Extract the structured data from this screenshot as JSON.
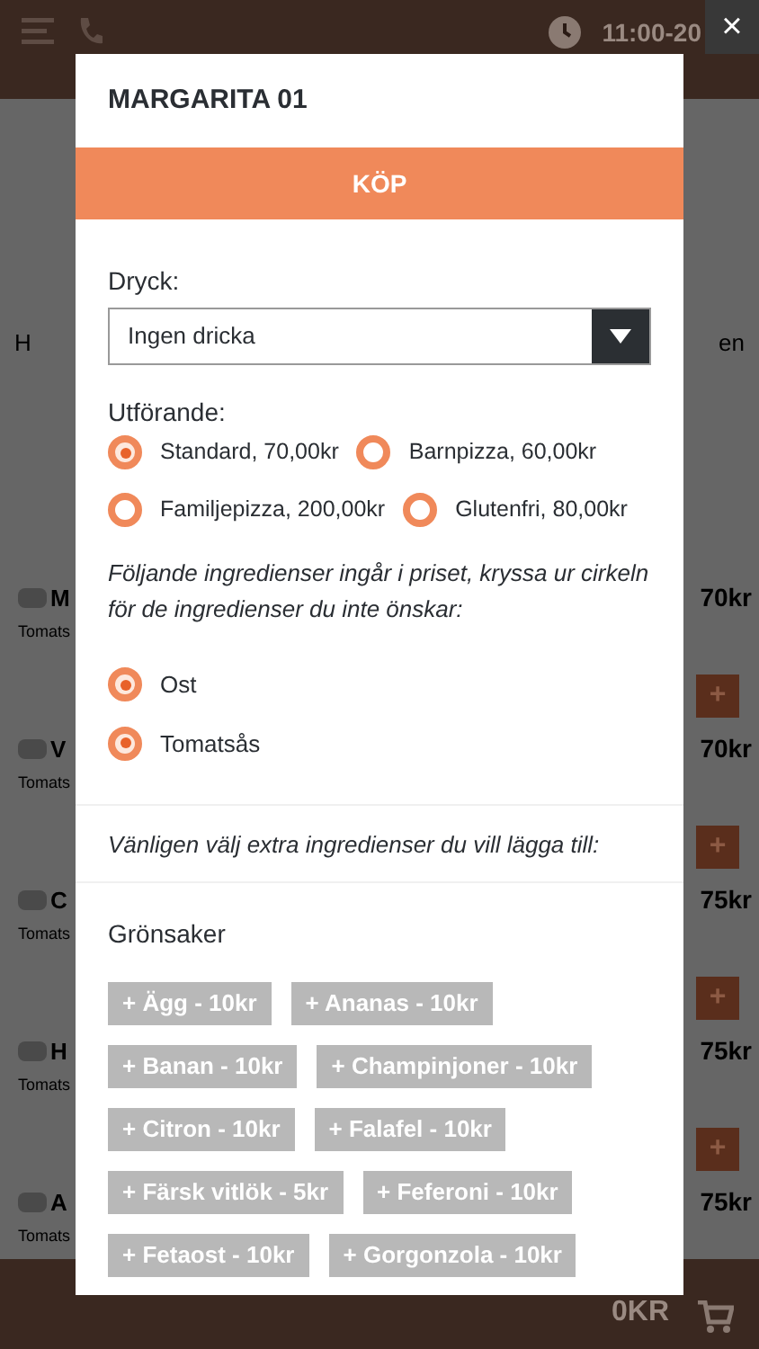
{
  "header": {
    "time": "11:00-20"
  },
  "background_tabs": [
    "H",
    "en"
  ],
  "menu_items": [
    {
      "name": "M",
      "checked": false,
      "description": "Tomats",
      "price": "70kr",
      "add_label": "+"
    },
    {
      "name": "V",
      "checked": false,
      "description": "Tomats",
      "price": "70kr",
      "add_label": "+"
    },
    {
      "name": "C",
      "checked": false,
      "description": "Tomats",
      "price": "75kr",
      "add_label": "+"
    },
    {
      "name": "H",
      "checked": false,
      "description": "Tomats",
      "price": "75kr",
      "add_label": "+"
    },
    {
      "name": "A",
      "checked": false,
      "description": "Tomats",
      "price": "75kr"
    }
  ],
  "cart": {
    "total": "0KR"
  },
  "close_button": "×",
  "modal": {
    "title": "MARGARITA 01",
    "buy_button": "KÖP",
    "drink": {
      "label": "Dryck:",
      "value": "Ingen dricka"
    },
    "variant": {
      "label": "Utförande:",
      "options": [
        {
          "label": "Standard, 70,00kr",
          "selected": true
        },
        {
          "label": "Barnpizza, 60,00kr",
          "selected": false
        },
        {
          "label": "Familjepizza, 200,00kr",
          "selected": false
        },
        {
          "label": "Glutenfri, 80,00kr",
          "selected": false
        }
      ]
    },
    "included": {
      "note": "Följande ingredienser ingår i priset, kryssa ur cirkeln för de ingredienser du inte önskar:",
      "ingredients": [
        {
          "label": "Ost",
          "checked": true
        },
        {
          "label": "Tomatsås",
          "checked": true
        }
      ]
    },
    "extras": {
      "note": "Vänligen välj extra ingredienser du vill lägga till:",
      "category": "Grönsaker",
      "items": [
        "+ Ägg - 10kr",
        "+ Ananas - 10kr",
        "+ Banan - 10kr",
        "+ Champinjoner - 10kr",
        "+ Citron - 10kr",
        "+ Falafel - 10kr",
        "+ Färsk vitlök - 5kr",
        "+ Feferoni - 10kr",
        "+ Fetaost - 10kr",
        "+ Gorgonzola - 10kr"
      ]
    }
  }
}
